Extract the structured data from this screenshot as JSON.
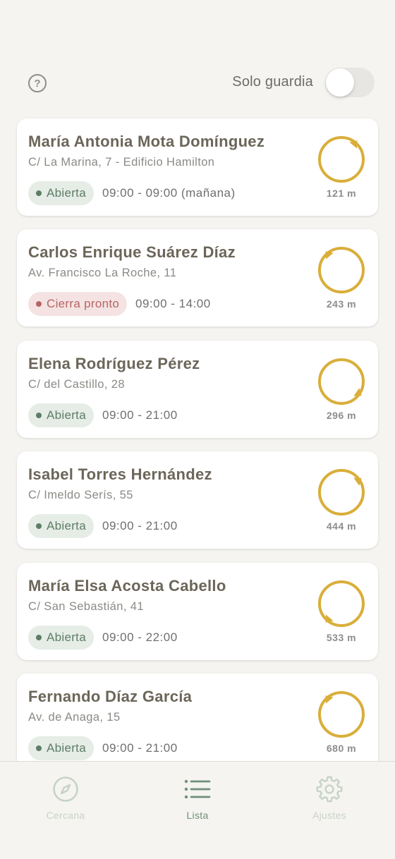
{
  "header": {
    "help_icon": "question-circle-icon",
    "help_glyph": "?",
    "guard_label": "Solo guardia",
    "guard_toggle_on": false
  },
  "colors": {
    "accent": "#d9ae3a",
    "open": "#5d7d66",
    "closing": "#b66565"
  },
  "pharmacies": [
    {
      "name": "María Antonia Mota Domínguez",
      "address": "C/ La Marina, 7 - Edificio Hamilton",
      "status": "Abierta",
      "status_kind": "open",
      "hours": "09:00 - 09:00 (mañana)",
      "distance": "121 m",
      "bearing_deg": 40
    },
    {
      "name": "Carlos Enrique Suárez Díaz",
      "address": "Av. Francisco La Roche, 11",
      "status": "Cierra pronto",
      "status_kind": "closing",
      "hours": "09:00 - 14:00",
      "distance": "243 m",
      "bearing_deg": 320
    },
    {
      "name": "Elena Rodríguez Pérez",
      "address": "C/ del Castillo, 28",
      "status": "Abierta",
      "status_kind": "open",
      "hours": "09:00 - 21:00",
      "distance": "296 m",
      "bearing_deg": 125
    },
    {
      "name": "Isabel Torres Hernández",
      "address": "C/ Imeldo Serís, 55",
      "status": "Abierta",
      "status_kind": "open",
      "hours": "09:00 - 21:00",
      "distance": "444 m",
      "bearing_deg": 55
    },
    {
      "name": "María Elsa Acosta Cabello",
      "address": "C/ San Sebastián, 41",
      "status": "Abierta",
      "status_kind": "open",
      "hours": "09:00 - 22:00",
      "distance": "533 m",
      "bearing_deg": 220
    },
    {
      "name": "Fernando Díaz García",
      "address": "Av. de Anaga, 15",
      "status": "Abierta",
      "status_kind": "open",
      "hours": "09:00 - 21:00",
      "distance": "680 m",
      "bearing_deg": 320
    }
  ],
  "tabs": [
    {
      "label": "Cercana",
      "icon": "compass-icon",
      "active": false
    },
    {
      "label": "Lista",
      "icon": "list-icon",
      "active": true
    },
    {
      "label": "Ajustes",
      "icon": "gear-icon",
      "active": false
    }
  ]
}
